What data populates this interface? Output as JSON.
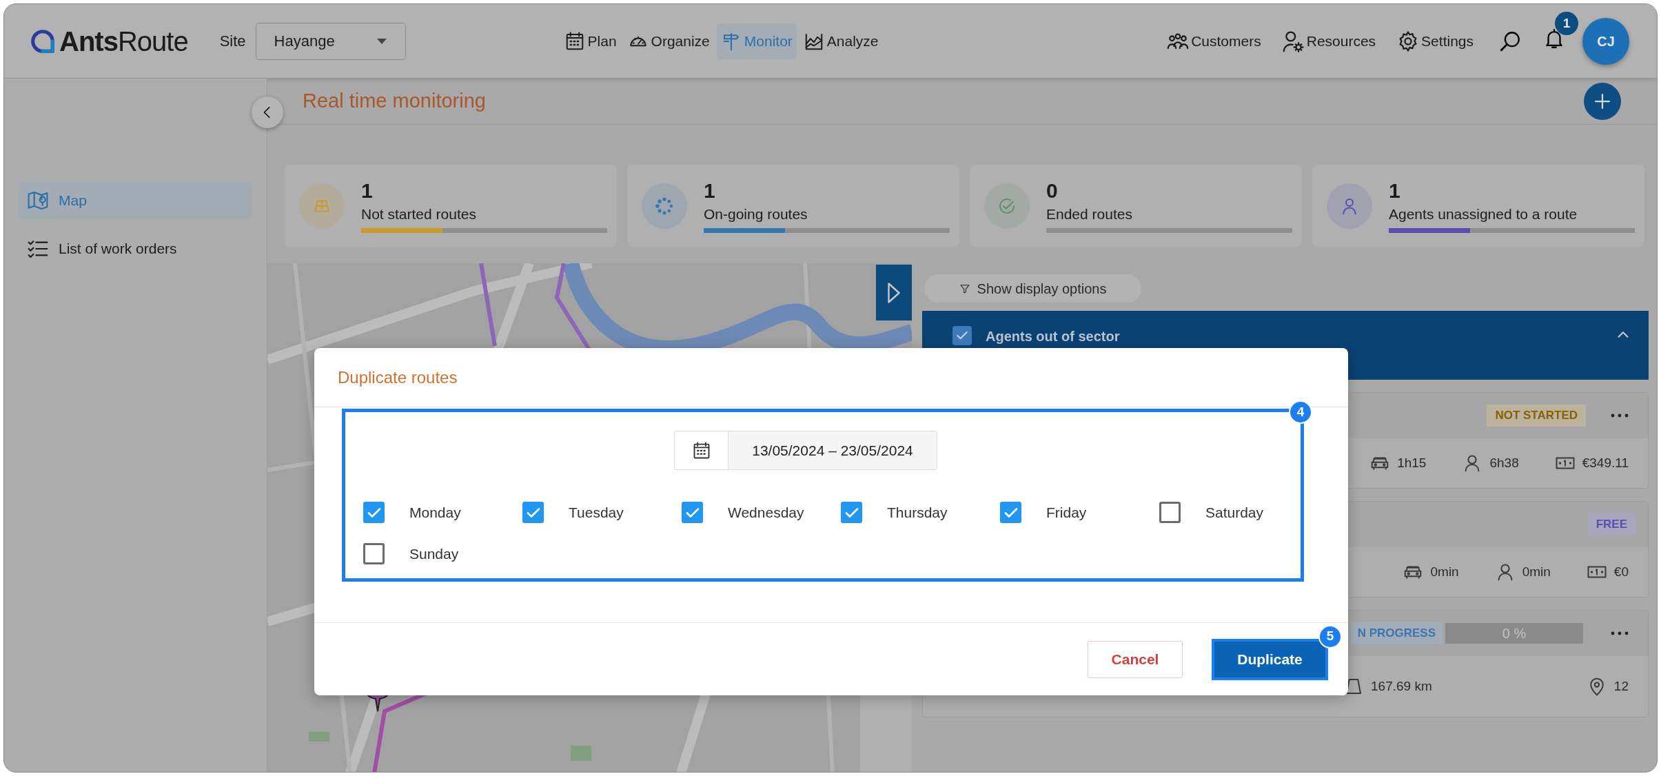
{
  "header": {
    "logo": "**Ants**Route",
    "site_label": "Site",
    "site_select": "Hayange",
    "nav": [
      {
        "label": "Plan",
        "selected": false
      },
      {
        "label": "Organize",
        "selected": false
      },
      {
        "label": "Monitor",
        "selected": true
      },
      {
        "label": "Analyze",
        "selected": false
      }
    ],
    "tools": [
      {
        "label": "Customers"
      },
      {
        "label": "Resources"
      },
      {
        "label": "Settings"
      }
    ],
    "notifications_count": "1",
    "avatar": "CJ"
  },
  "sidebar": {
    "items": [
      {
        "label": "Map",
        "selected": true
      },
      {
        "label": "List of work orders",
        "selected": false
      }
    ]
  },
  "page_title": "Real time monitoring",
  "stats": [
    {
      "value": "1",
      "label": "Not started routes",
      "level": 0.33,
      "color": "#c99a2c"
    },
    {
      "value": "1",
      "label": "On-going routes",
      "level": 0.33,
      "color": "#3a75ad"
    },
    {
      "value": "0",
      "label": "Ended routes",
      "level": 0,
      "color": "#5f8f6c"
    },
    {
      "value": "1",
      "label": "Agents unassigned to a route",
      "level": 0.33,
      "color": "#5a4fb0"
    }
  ],
  "display_options_button": "Show display options",
  "group": {
    "label": "Agents out of sector",
    "checked": true,
    "expanded": true
  },
  "route_cards": [
    {
      "kind": "not_started",
      "status": "NOT STARTED",
      "stats": [
        {
          "kind": "drive",
          "value": "1h15"
        },
        {
          "kind": "work",
          "value": "6h38"
        },
        {
          "kind": "cost",
          "value": "€349.11"
        }
      ]
    },
    {
      "kind": "free",
      "status": "FREE",
      "stats": [
        {
          "kind": "drive",
          "value": "0min"
        },
        {
          "kind": "work",
          "value": "0min"
        },
        {
          "kind": "cost",
          "value": "€0"
        }
      ]
    },
    {
      "kind": "in_progress",
      "status": "N PROGRESS",
      "progress": {
        "level": 0,
        "reading": "0 %"
      },
      "stats": [
        {
          "kind": "distance",
          "value": "167.69 km"
        },
        {
          "kind": "stops",
          "value": "12"
        }
      ]
    }
  ],
  "dialog": {
    "title": "Duplicate routes",
    "step": "4",
    "date_range": "13/05/2024 – 23/05/2024",
    "days": [
      {
        "label": "Monday",
        "checked": true
      },
      {
        "label": "Tuesday",
        "checked": true
      },
      {
        "label": "Wednesday",
        "checked": true
      },
      {
        "label": "Thursday",
        "checked": true
      },
      {
        "label": "Friday",
        "checked": true
      },
      {
        "label": "Saturday",
        "checked": false
      },
      {
        "label": "Sunday",
        "checked": false
      }
    ],
    "buttons": [
      {
        "label": "Cancel",
        "kind": "secondary"
      },
      {
        "label": "Duplicate",
        "kind": "primary",
        "step": "5"
      }
    ]
  }
}
